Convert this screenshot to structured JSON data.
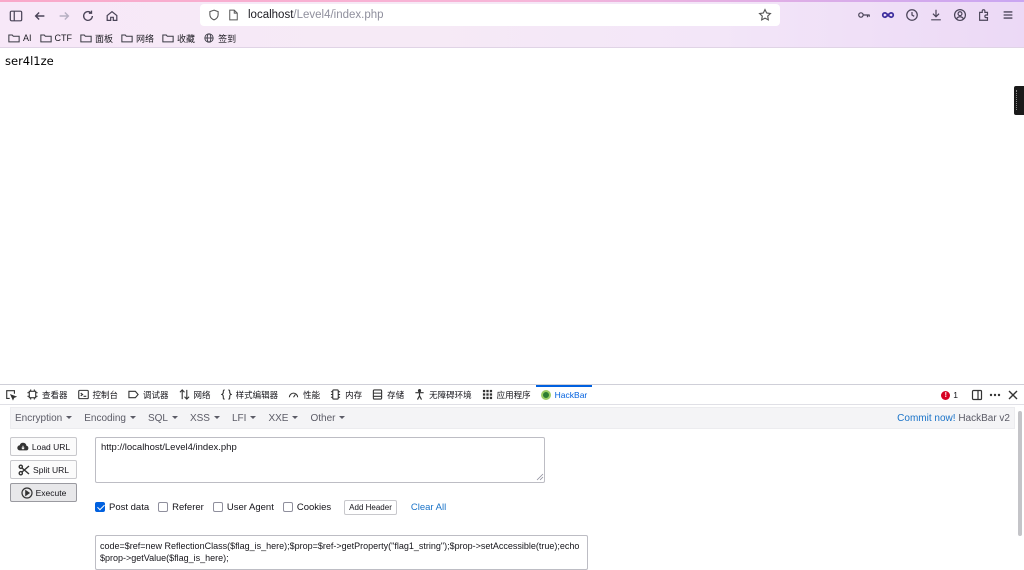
{
  "browser": {
    "url_host": "localhost",
    "url_path": "/Level4/index.php",
    "bookmarks": [
      {
        "label": "AI"
      },
      {
        "label": "CTF"
      },
      {
        "label": "面板"
      },
      {
        "label": "网络"
      },
      {
        "label": "收藏"
      },
      {
        "label": "签到"
      }
    ]
  },
  "page": {
    "text": "ser4l1ze"
  },
  "devtools": {
    "tabs": [
      "查看器",
      "控制台",
      "调试器",
      "网络",
      "样式编辑器",
      "性能",
      "内存",
      "存储",
      "无障碍环境",
      "应用程序",
      "HackBar"
    ],
    "active_tab": "HackBar",
    "error_count": "1"
  },
  "hackbar": {
    "menus": [
      "Encryption",
      "Encoding",
      "SQL",
      "XSS",
      "LFI",
      "XXE",
      "Other"
    ],
    "commit_link": "Commit now!",
    "version": "HackBar v2",
    "load_url": "Load URL",
    "split_url": "Split URL",
    "execute": "Execute",
    "url_value": "http://localhost/Level4/index.php",
    "options": [
      {
        "label": "Post data",
        "checked": true
      },
      {
        "label": "Referer",
        "checked": false
      },
      {
        "label": "User Agent",
        "checked": false
      },
      {
        "label": "Cookies",
        "checked": false
      }
    ],
    "add_header": "Add Header",
    "clear_all": "Clear All",
    "post_data": "code=$ref=new ReflectionClass($flag_is_here);$prop=$ref->getProperty(\"flag1_string\");$prop->setAccessible(true);echo $prop->getValue($flag_is_here);"
  },
  "colors": {
    "accent": "#0060df",
    "link": "#1a73c8",
    "error": "#d70022"
  }
}
